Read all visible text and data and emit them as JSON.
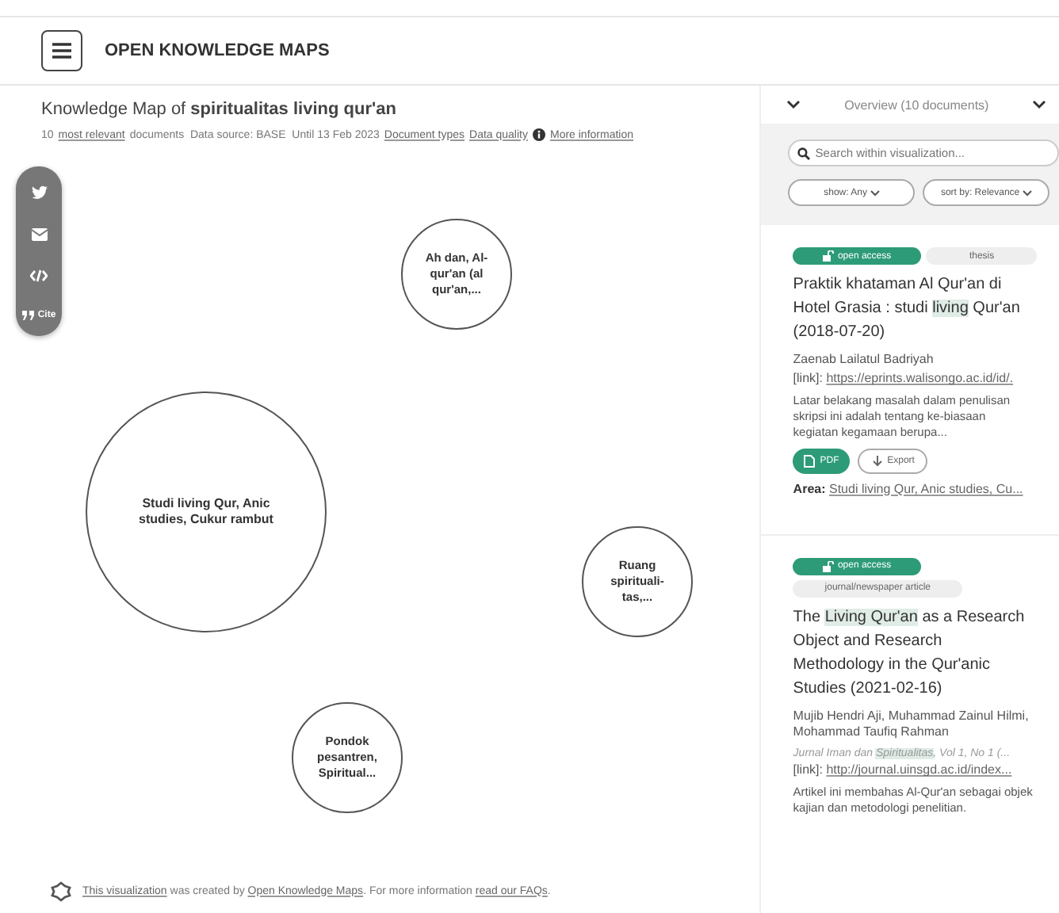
{
  "header": {
    "brand": "OPEN KNOWLEDGE MAPS"
  },
  "heading": {
    "prefix": "Knowledge Map of ",
    "query": "spiritualitas living qur'an"
  },
  "subtitle": {
    "count": "10",
    "relevant": "most relevant",
    "rest": "documents  Data source: BASE  Until 13 Feb 2023",
    "links": [
      "Document types",
      "Data quality"
    ]
  },
  "more_info": "More information",
  "share": {
    "cite": "Cite"
  },
  "bubbles": [
    {
      "label": "Ah dan, Al-qur'an (al qur'an,..."
    },
    {
      "label": "Studi living Qur, Anic studies, Cukur rambut"
    },
    {
      "label": "Ruang spirituali-tas,..."
    },
    {
      "label": "Pondok pesantren, Spiritual..."
    }
  ],
  "footer": {
    "link1": "This visualization",
    "text1": "was created by",
    "link2": "Open Knowledge Maps",
    "text2": ". For more information",
    "link3": "read our FAQs",
    "end": "."
  },
  "panel": {
    "overview": "Overview (10 documents)",
    "search": {
      "placeholder": "Search within visualization..."
    },
    "show": "show: Any",
    "sort": "sort by: Relevance"
  },
  "documents": [
    {
      "open_access": "open access",
      "type": "thesis",
      "type_inline": true,
      "title": [
        {
          "text": "Praktik khataman Al Qur'an di Hotel Grasia : studi ",
          "highlight": false
        },
        {
          "text": "living",
          "highlight": true
        },
        {
          "text": " Qur'an (2018-07-20)",
          "highlight": false
        }
      ],
      "authors": "Zaenab Lailatul Badriyah",
      "link_label": "[link]:",
      "link": "https://eprints.walisongo.ac.id/id/.",
      "abstract": "Latar belakang masalah dalam penulisan skripsi ini adalah tentang ke-biasaan kegiatan kegamaan berupa...",
      "pdf": "PDF",
      "export": "Export",
      "area_label": "Area:",
      "area": "Studi living Qur, Anic studies, Cu..."
    },
    {
      "open_access": "open access",
      "type": "journal/newspaper article",
      "type_inline": false,
      "title": [
        {
          "text": "The ",
          "highlight": false
        },
        {
          "text": "Living Qur'an",
          "highlight": true
        },
        {
          "text": " as a Research Object and Research Methodology in the Qur'anic Studies (2021-02-16)",
          "highlight": false
        }
      ],
      "authors": "Mujib Hendri Aji, Muhammad Zainul Hilmi, Mohammad Taufiq Rahman",
      "journal": [
        {
          "text": "Jurnal Iman dan ",
          "highlight": false
        },
        {
          "text": "Spiritualitas",
          "highlight": true
        },
        {
          "text": ", Vol 1, No 1 (...",
          "highlight": false
        }
      ],
      "link_label": "[link]:",
      "link": "http://journal.uinsgd.ac.id/index...",
      "abstract": "Artikel ini membahas Al-Qur'an sebagai objek kajian dan metodologi penelitian."
    }
  ]
}
